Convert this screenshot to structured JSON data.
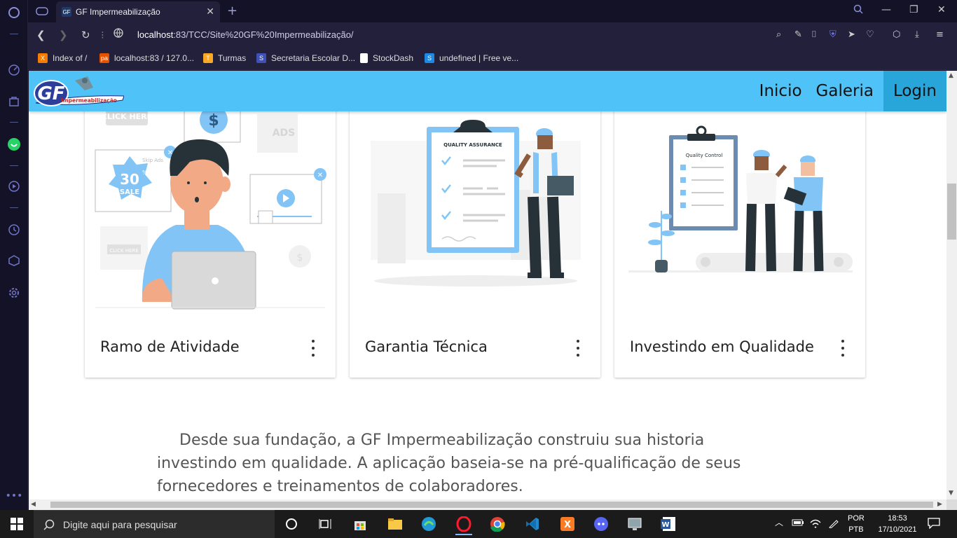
{
  "browser": {
    "tab_title": "GF Impermeabilização",
    "new_tab": "+",
    "url_host": "localhost",
    "url_path": ":83/TCC/Site%20GF%20Impermeabilização/",
    "bookmarks": [
      {
        "label": "Index of /",
        "color": "#f57c00",
        "glyph": "X"
      },
      {
        "label": "localhost:83 / 127.0...",
        "color": "#e65100",
        "glyph": "pa"
      },
      {
        "label": "Turmas",
        "color": "#f9a825",
        "glyph": "T"
      },
      {
        "label": "Secretaria Escolar D...",
        "color": "#3f51b5",
        "glyph": "S"
      },
      {
        "label": "StockDash",
        "color": "#ffffff",
        "glyph": ""
      },
      {
        "label": "undefined | Free ve...",
        "color": "#1e88e5",
        "glyph": "S"
      }
    ]
  },
  "site": {
    "logo_text": "GF",
    "logo_sub": "Impermeabilização",
    "menu": [
      {
        "label": "Inicio"
      },
      {
        "label": "Galeria"
      },
      {
        "label": "Login"
      }
    ],
    "cards": [
      {
        "title": "Ramo de Atividade",
        "illustration": "advertising-icon"
      },
      {
        "title": "Garantia Técnica",
        "illustration": "quality-assurance-icon",
        "board_label": "QUALITY ASSURANCE"
      },
      {
        "title": "Investindo em Qualidade",
        "illustration": "quality-control-icon",
        "board_label": "Quality Control"
      }
    ],
    "card1_texts": {
      "click_here": "CLICK HERE",
      "ads": "ADS",
      "sale_num": "30",
      "sale_pct": "%",
      "sale_label": "SALE",
      "skip_ads": "Skip Ads",
      "click_here_small": "CLICK HERE"
    },
    "paragraph": "Desde sua fundação, a GF Impermeabilização construiu sua historia investindo em qualidade. A aplicação baseia-se na pré-qualificação de seus fornecedores e treinamentos de colaboradores."
  },
  "taskbar": {
    "search_placeholder": "Digite aqui para pesquisar",
    "lang_top": "POR",
    "lang_bottom": "PTB",
    "time": "18:53",
    "date": "17/10/2021"
  },
  "colors": {
    "header": "#4fc3f7",
    "login_active": "#29a6d9",
    "browser_dark": "#141226"
  }
}
